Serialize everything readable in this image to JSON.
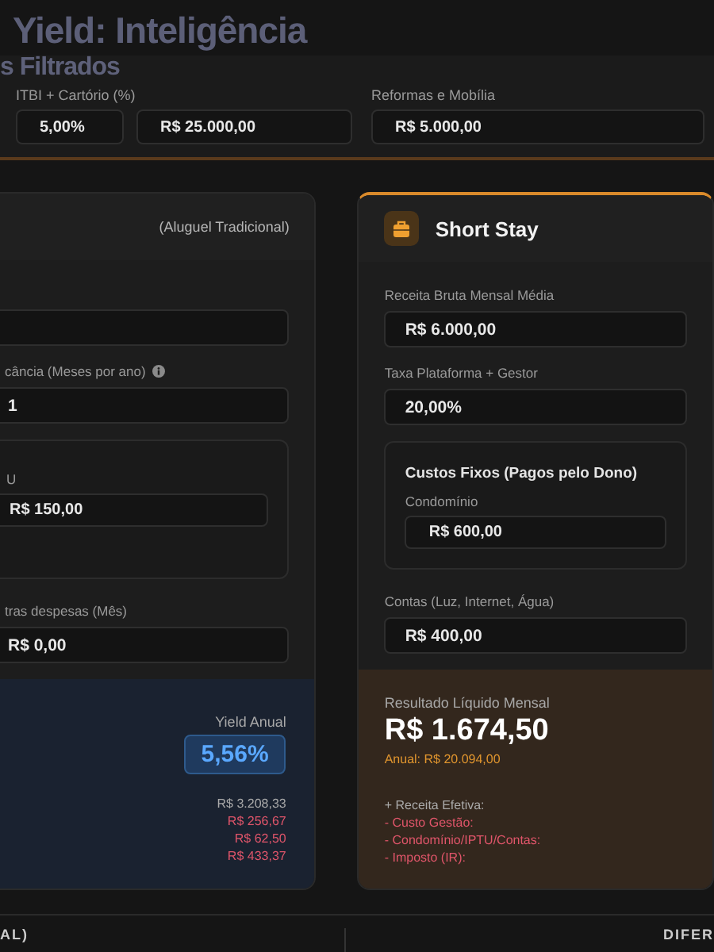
{
  "overlay_title": {
    "lines": [
      "Yield: Inteligência",
      "s Filtrados"
    ]
  },
  "top_panel": {
    "fields": [
      {
        "label": "ITBI + Cartório (%)",
        "values": [
          "5,00%",
          "R$ 25.000,00"
        ]
      },
      {
        "label": "Reformas e Mobília",
        "values": [
          "R$ 5.000,00"
        ]
      }
    ]
  },
  "panels": [
    {
      "kind": "traditional",
      "subtitle": "(Aluguel Tradicional)",
      "fields": [
        {
          "kind": "field"
        },
        {
          "kind": "field",
          "label": "cância (Meses por ano)",
          "info": true,
          "value": "1"
        },
        {
          "kind": "group",
          "label": "U",
          "value": "R$ 150,00"
        },
        {
          "kind": "field",
          "label": "tras despesas (Mês)",
          "value": "R$ 0,00"
        }
      ],
      "result": {
        "label": "Yield Anual",
        "badge": "5,56%",
        "lines": [
          {
            "text": "R$ 3.208,33",
            "kind": "positive"
          },
          {
            "text": "R$ 256,67",
            "kind": "negative"
          },
          {
            "text": "R$ 62,50",
            "kind": "negative"
          },
          {
            "text": "R$ 433,37",
            "kind": "negative"
          }
        ]
      }
    },
    {
      "kind": "short_stay",
      "title": "Short Stay",
      "fields": [
        {
          "kind": "field",
          "label": "Receita Bruta Mensal Média",
          "value": "R$ 6.000,00"
        },
        {
          "kind": "field",
          "label": "Taxa Plataforma + Gestor",
          "value": "20,00%"
        },
        {
          "kind": "group",
          "title": "Custos Fixos (Pagos pelo Dono)",
          "label": "Condomínio",
          "value": "R$ 600,00"
        },
        {
          "kind": "field",
          "label": "Contas (Luz, Internet, Água)",
          "value": "R$ 400,00"
        }
      ],
      "result": {
        "label": "Resultado Líquido Mensal",
        "value": "R$ 1.674,50",
        "annual": "Anual: R$ 20.094,00",
        "lines": [
          {
            "text": "+ Receita Efetiva:",
            "kind": "positive"
          },
          {
            "text": "- Custo Gestão:",
            "kind": "negative"
          },
          {
            "text": "- Condomínio/IPTU/Contas:",
            "kind": "negative"
          },
          {
            "text": "- Imposto (IR):",
            "kind": "negative"
          }
        ]
      }
    }
  ],
  "footer": {
    "columns": [
      "AL)",
      "DIFER"
    ]
  }
}
